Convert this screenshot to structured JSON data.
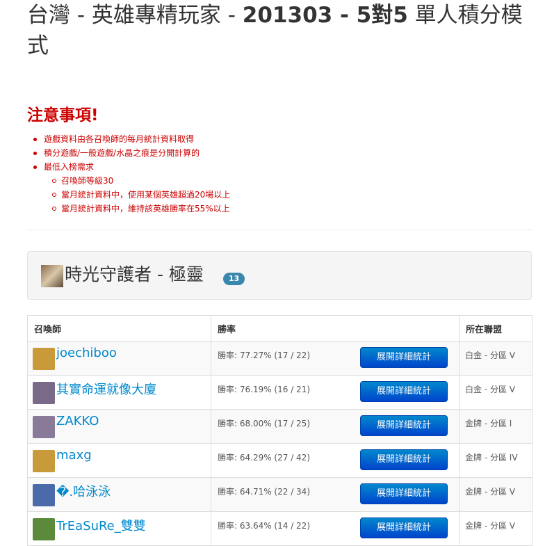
{
  "page": {
    "title_prefix": "台灣 - 英雄專精玩家 - ",
    "title_bold": "201303 - 5對5",
    "title_suffix": " 單人積分模式"
  },
  "notice": {
    "title": "注意事項!",
    "items": [
      "遊戲資料由各召喚師的每月統計資料取得",
      "積分遊戲/一般遊戲/水晶之痕是分開計算的",
      "最低入榜需求"
    ],
    "sub_items": [
      "召喚師等級30",
      "當月統計資料中，使用某個英雄超過20場以上",
      "當月統計資料中，維持該英雄勝率在55%以上"
    ]
  },
  "hero": {
    "name": "時光守護者 - 極靈",
    "count": "13"
  },
  "table": {
    "headers": {
      "summoner": "召喚師",
      "winrate": "勝率",
      "league": "所在聯盟"
    },
    "button_label": "展開詳細統計",
    "rows": [
      {
        "name": "joechiboo",
        "rate": "勝率: 77.27% (17 / 22)",
        "league": "白金 - 分區 V",
        "avatar_color": "#c89a3a"
      },
      {
        "name": "其實命運就像大廈",
        "rate": "勝率: 76.19% (16 / 21)",
        "league": "白金 - 分區 V",
        "avatar_color": "#7a6a8a"
      },
      {
        "name": "ZAKKO",
        "rate": "勝率: 68.00% (17 / 25)",
        "league": "金牌 - 分區 I",
        "avatar_color": "#8a7a9a"
      },
      {
        "name": "maxg",
        "rate": "勝率: 64.29% (27 / 42)",
        "league": "金牌 - 分區 IV",
        "avatar_color": "#c89a3a"
      },
      {
        "name": "�.哈泳泳",
        "rate": "勝率: 64.71% (22 / 34)",
        "league": "金牌 - 分區 V",
        "avatar_color": "#4a6aaa"
      },
      {
        "name": "TrEaSuRe_雙雙",
        "rate": "勝率: 63.64% (14 / 22)",
        "league": "金牌 - 分區 V",
        "avatar_color": "#5a8a3a"
      }
    ]
  }
}
